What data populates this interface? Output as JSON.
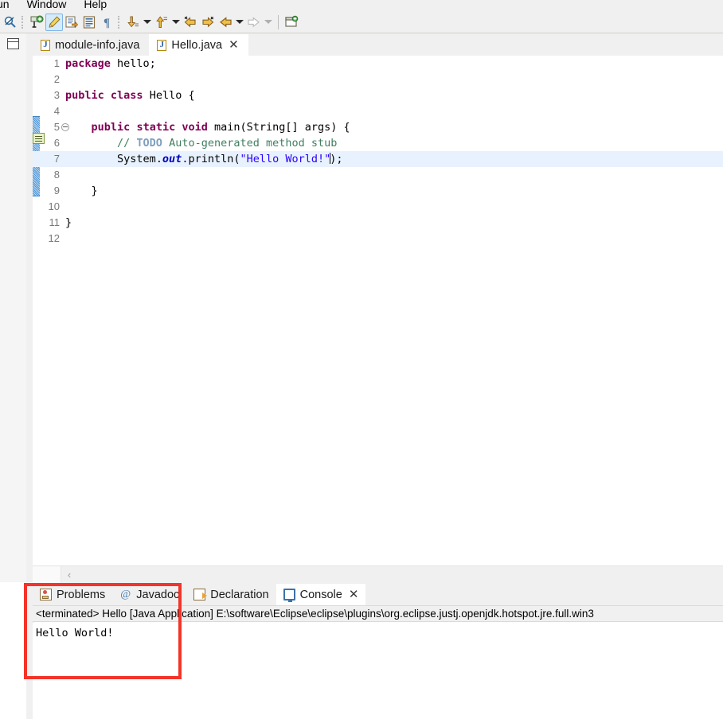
{
  "menubar": {
    "items": [
      "un",
      "Window",
      "Help"
    ]
  },
  "toolbar": {
    "buttons": [
      {
        "name": "search-icon",
        "label": "Search"
      },
      {
        "name": "new-java-package-icon",
        "label": "New Java Package"
      },
      {
        "name": "toggle-mark-occurrences-icon",
        "label": "Toggle Mark Occurrences",
        "active": true
      },
      {
        "name": "open-task-icon",
        "label": "Open Task"
      },
      {
        "name": "toggle-block-selection-icon",
        "label": "Toggle Block Selection"
      },
      {
        "name": "show-whitespace-icon",
        "label": "Show Whitespace Characters"
      },
      {
        "name": "next-annotation-icon",
        "label": "Next Annotation"
      },
      {
        "name": "previous-annotation-icon",
        "label": "Previous Annotation"
      },
      {
        "name": "back-to-icon",
        "label": "Back"
      },
      {
        "name": "forward-to-icon",
        "label": "Forward"
      },
      {
        "name": "previous-edit-location-icon",
        "label": "Last Edit Location"
      },
      {
        "name": "next-edit-location-icon",
        "label": "Next Edit Location"
      },
      {
        "name": "new-window-icon",
        "label": "New Window"
      }
    ]
  },
  "editor": {
    "tabs": [
      {
        "label": "module-info.java",
        "selected": false,
        "closable": false
      },
      {
        "label": "Hello.java",
        "selected": true,
        "closable": true,
        "close_glyph": "✕"
      }
    ],
    "gutter_line_numbers": [
      "1",
      "2",
      "3",
      "4",
      "5",
      "6",
      "7",
      "8",
      "9",
      "10",
      "11",
      "12"
    ],
    "highlight_line": 7,
    "fold_line": 5,
    "lines": [
      {
        "n": "1",
        "segments": [
          {
            "t": "package",
            "c": "kw"
          },
          {
            "t": " hello;",
            "c": "plain"
          }
        ]
      },
      {
        "n": "2",
        "segments": []
      },
      {
        "n": "3",
        "segments": [
          {
            "t": "public",
            "c": "kw"
          },
          {
            "t": " ",
            "c": "plain"
          },
          {
            "t": "class",
            "c": "kw"
          },
          {
            "t": " Hello {",
            "c": "plain"
          }
        ]
      },
      {
        "n": "4",
        "segments": []
      },
      {
        "n": "5",
        "segments": [
          {
            "t": "    ",
            "c": "plain"
          },
          {
            "t": "public",
            "c": "kw"
          },
          {
            "t": " ",
            "c": "plain"
          },
          {
            "t": "static",
            "c": "kw"
          },
          {
            "t": " ",
            "c": "plain"
          },
          {
            "t": "void",
            "c": "kw"
          },
          {
            "t": " main(String[] args) {",
            "c": "plain"
          }
        ]
      },
      {
        "n": "6",
        "segments": [
          {
            "t": "        ",
            "c": "plain"
          },
          {
            "t": "// ",
            "c": "cmt"
          },
          {
            "t": "TODO",
            "c": "todo"
          },
          {
            "t": " Auto-generated method stub",
            "c": "cmt"
          }
        ]
      },
      {
        "n": "7",
        "segments": [
          {
            "t": "        System.",
            "c": "plain"
          },
          {
            "t": "out",
            "c": "stat"
          },
          {
            "t": ".println(",
            "c": "plain"
          },
          {
            "t": "\"Hello World!\"",
            "c": "str"
          },
          {
            "t": ");",
            "c": "plain"
          }
        ],
        "caret_after_segment": 3
      },
      {
        "n": "8",
        "segments": []
      },
      {
        "n": "9",
        "segments": [
          {
            "t": "    }",
            "c": "plain"
          }
        ]
      },
      {
        "n": "10",
        "segments": []
      },
      {
        "n": "11",
        "segments": [
          {
            "t": "}",
            "c": "plain"
          }
        ]
      },
      {
        "n": "12",
        "segments": []
      }
    ],
    "scrollbar": {
      "left_arrow": "‹"
    }
  },
  "bottom_panel": {
    "tabs": [
      {
        "label": "Problems",
        "icon": "problems-icon",
        "selected": false,
        "closable": false
      },
      {
        "label": "Javadoc",
        "icon": "javadoc-icon",
        "selected": false,
        "closable": false
      },
      {
        "label": "Declaration",
        "icon": "declaration-icon",
        "selected": false,
        "closable": false
      },
      {
        "label": "Console",
        "icon": "console-icon",
        "selected": true,
        "closable": true,
        "close_glyph": "✕"
      }
    ],
    "console_header": "<terminated> Hello [Java Application] E:\\software\\Eclipse\\eclipse\\plugins\\org.eclipse.justj.openjdk.hotspot.jre.full.win3",
    "console_output": [
      "Hello World!"
    ]
  },
  "annotation": {
    "name": "red-highlight-box",
    "color": "#f4342a"
  },
  "colors": {
    "keyword": "#7f0055",
    "comment": "#3f7f5f",
    "todo": "#7f9fbf",
    "string": "#2a00ff",
    "static_field": "#0000c0",
    "line_highlight": "#e8f2fe",
    "chrome": "#f0f0f0",
    "accent_selection": "#d6ebfa"
  }
}
